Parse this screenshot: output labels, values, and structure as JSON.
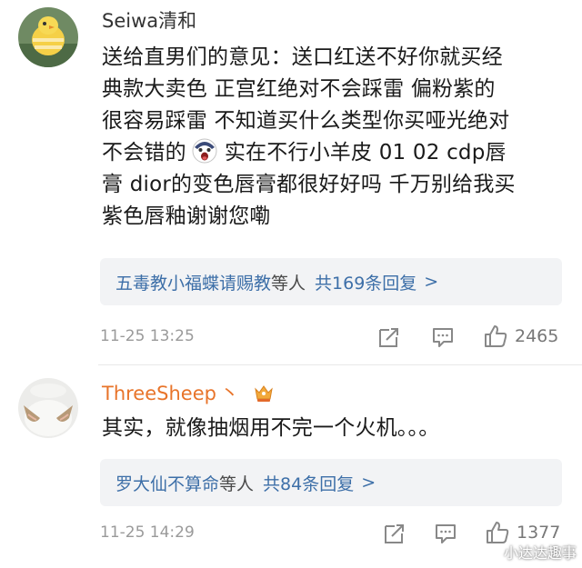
{
  "comments": [
    {
      "username": "Seiwa清和",
      "username_color": "#333333",
      "text_lines": [
        "送给直男们的意见：送口红送不好你就买经",
        "典款大卖色  正宫红绝对不会踩雷 偏粉紫的",
        "很容易踩雷 不知道买什么类型你买哑光绝对",
        "不会错的",
        "实在不行小羊皮 01 02 cdp唇",
        "膏 dior的变色唇膏都很好好吗 千万别给我买",
        "紫色唇釉谢谢您嘞"
      ],
      "emoji_icon": "grimace-emoji-icon",
      "replies": {
        "who": "五毒教小福蝶请赐教",
        "mid": "等人",
        "count": "共169条回复",
        "chevron": ">"
      },
      "time": "11-25 13:25",
      "likes": "2465"
    },
    {
      "username": "ThreeSheep",
      "username_suffix": "丶",
      "username_color": "#e8742a",
      "badge_icon": "crown-badge-icon",
      "text_lines": [
        "其实，就像抽烟用不完一个火机。。。"
      ],
      "replies": {
        "who": "罗大仙不算命",
        "mid": "等人",
        "count": "共84条回复",
        "chevron": ">"
      },
      "time": "11-25 14:29",
      "likes": "1377"
    }
  ],
  "watermark": "小达达趣事",
  "colors": {
    "link": "#3d6fa8",
    "reply_bg": "#f2f3f5",
    "meta": "#9a9a9a",
    "orange": "#e8742a"
  }
}
